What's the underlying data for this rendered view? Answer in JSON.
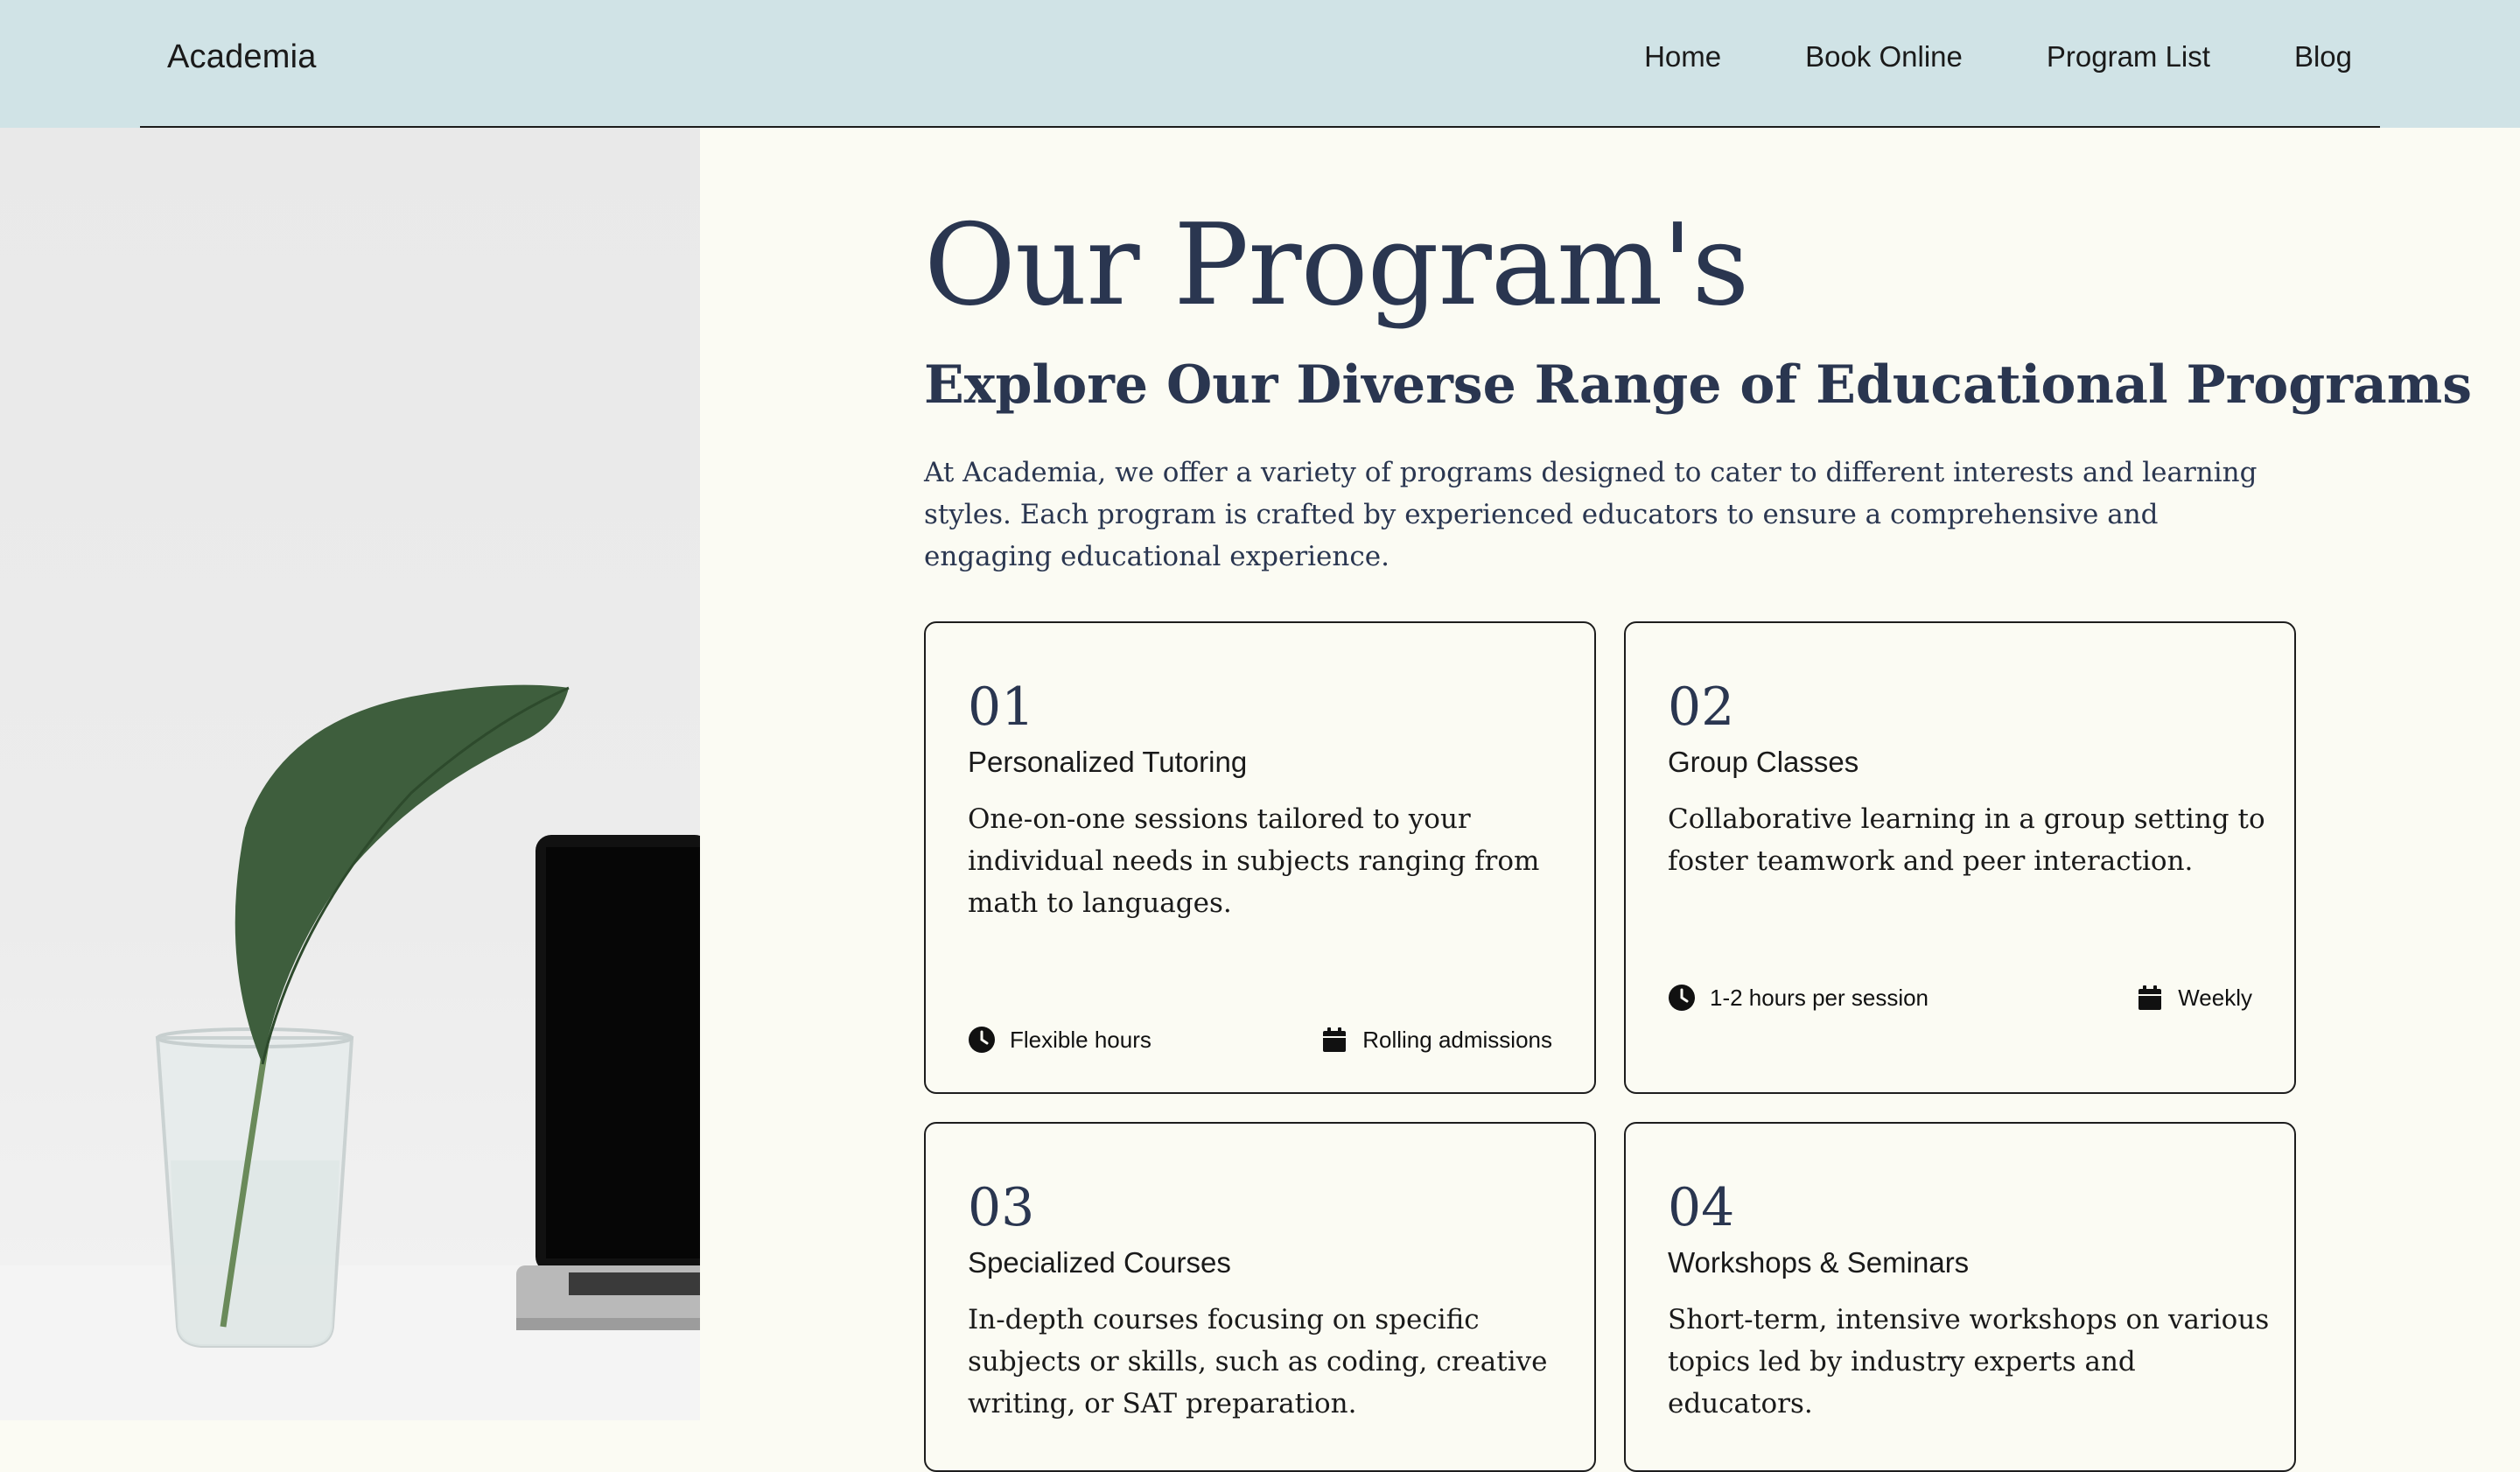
{
  "header": {
    "logo": "Academia",
    "nav": [
      "Home",
      "Book Online",
      "Program List",
      "Blog"
    ]
  },
  "page": {
    "title": "Our Program's",
    "subtitle": "Explore Our Diverse Range of Educational Programs",
    "intro": "At Academia, we offer a variety of programs designed to cater to different interests and learning styles. Each program is crafted by experienced educators to ensure a comprehensive and engaging educational experience."
  },
  "programs": [
    {
      "number": "01",
      "title": "Personalized Tutoring",
      "description": "One-on-one sessions tailored to your individual needs in subjects ranging from math to languages.",
      "duration": "Flexible hours",
      "schedule": "Rolling admissions"
    },
    {
      "number": "02",
      "title": "Group Classes",
      "description": "Collaborative learning in a group setting to foster teamwork and peer interaction.",
      "duration": "1-2 hours per session",
      "schedule": "Weekly"
    },
    {
      "number": "03",
      "title": "Specialized Courses",
      "description": "In-depth courses focusing on specific subjects or skills, such as coding, creative writing, or SAT preparation.",
      "duration": "",
      "schedule": ""
    },
    {
      "number": "04",
      "title": "Workshops & Seminars",
      "description": "Short-term, intensive workshops on various topics led by industry experts and educators.",
      "duration": "",
      "schedule": ""
    }
  ],
  "icons": {
    "duration": "clock-icon",
    "schedule": "calendar-icon"
  },
  "colors": {
    "header_bg": "#d0e3e6",
    "page_bg": "#fbfbf3",
    "heading": "#2a3650"
  }
}
